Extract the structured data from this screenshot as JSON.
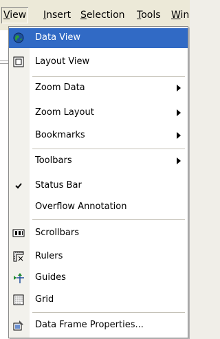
{
  "menubar": {
    "items": [
      {
        "label": "View",
        "u": "V",
        "rest": "iew"
      },
      {
        "label": "Insert",
        "u": "I",
        "rest": "nsert"
      },
      {
        "label": "Selection",
        "u": "S",
        "rest": "election"
      },
      {
        "label": "Tools",
        "u": "T",
        "rest": "ools"
      },
      {
        "label": "Win",
        "u": "W",
        "rest": "in"
      }
    ]
  },
  "menu": {
    "items": [
      {
        "label": "Data View",
        "icon": "globe-icon"
      },
      {
        "label": "Layout View",
        "icon": "page-icon"
      },
      {
        "label": "Zoom Data",
        "submenu": true
      },
      {
        "label": "Zoom Layout",
        "submenu": true
      },
      {
        "label": "Bookmarks",
        "submenu": true
      },
      {
        "label": "Toolbars",
        "submenu": true
      },
      {
        "label": "Status Bar",
        "checked": true
      },
      {
        "label": "Overflow Annotation"
      },
      {
        "label": "Scrollbars",
        "icon": "scrollbars-icon"
      },
      {
        "label": "Rulers",
        "icon": "rulers-icon"
      },
      {
        "label": "Guides",
        "icon": "guides-icon"
      },
      {
        "label": "Grid",
        "icon": "grid-icon"
      },
      {
        "label": "Data Frame Properties...",
        "icon": "properties-icon"
      }
    ]
  },
  "colors": {
    "highlight": "#316ac5"
  }
}
